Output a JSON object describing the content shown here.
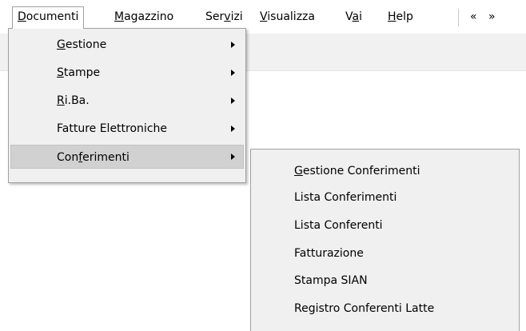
{
  "menubar": {
    "items": [
      {
        "pre": "",
        "key": "D",
        "post": "ocumenti"
      },
      {
        "pre": "",
        "key": "M",
        "post": "agazzino"
      },
      {
        "pre": "Ser",
        "key": "v",
        "post": "izi"
      },
      {
        "pre": "",
        "key": "V",
        "post": "isualizza"
      },
      {
        "pre": "V",
        "key": "a",
        "post": "i"
      },
      {
        "pre": "",
        "key": "H",
        "post": "elp"
      }
    ],
    "nav": {
      "prev": "«",
      "next": "»"
    }
  },
  "dropdown": {
    "items": [
      {
        "pre": "",
        "key": "G",
        "post": "estione"
      },
      {
        "pre": "",
        "key": "S",
        "post": "tampe"
      },
      {
        "pre": "",
        "key": "R",
        "post": "i.Ba."
      },
      {
        "pre": "Fatture Elettroniche",
        "key": "",
        "post": ""
      },
      {
        "pre": "Con",
        "key": "f",
        "post": "erimenti"
      }
    ],
    "highlighted_index": 4
  },
  "submenu": {
    "items": [
      {
        "pre": "",
        "key": "G",
        "post": "estione Conferimenti"
      },
      {
        "pre": "Lista Conferimenti",
        "key": "",
        "post": ""
      },
      {
        "pre": "Lista Conferenti",
        "key": "",
        "post": ""
      },
      {
        "pre": "Fatturazione",
        "key": "",
        "post": ""
      },
      {
        "pre": "Stampa SIAN",
        "key": "",
        "post": ""
      },
      {
        "pre": "Registro Conferenti Latte",
        "key": "",
        "post": ""
      }
    ]
  }
}
